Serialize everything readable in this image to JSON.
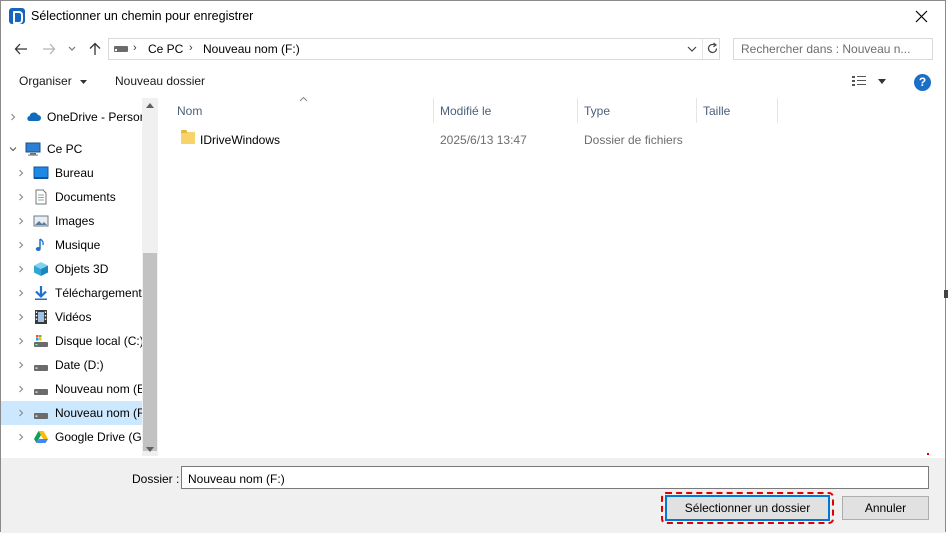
{
  "window": {
    "title": "Sélectionner un chemin pour enregistrer"
  },
  "address_bar": {
    "crumbs": [
      "Ce PC",
      "Nouveau nom (F:)"
    ]
  },
  "search": {
    "placeholder": "Rechercher dans : Nouveau n..."
  },
  "toolbar": {
    "organize_label": "Organiser",
    "new_folder_label": "Nouveau dossier",
    "help_label": "?"
  },
  "nav_pane": {
    "items": [
      {
        "label": "OneDrive - Person",
        "icon": "onedrive-cloud-icon",
        "level": 0,
        "selected": false
      },
      {
        "label": "Ce PC",
        "icon": "computer-icon",
        "level": 0,
        "expanded": true,
        "selected": false
      },
      {
        "label": "Bureau",
        "icon": "desktop-icon",
        "level": 1,
        "selected": false
      },
      {
        "label": "Documents",
        "icon": "documents-icon",
        "level": 1,
        "selected": false
      },
      {
        "label": "Images",
        "icon": "pictures-icon",
        "level": 1,
        "selected": false
      },
      {
        "label": "Musique",
        "icon": "music-icon",
        "level": 1,
        "selected": false
      },
      {
        "label": "Objets 3D",
        "icon": "3d-objects-icon",
        "level": 1,
        "selected": false
      },
      {
        "label": "Téléchargements",
        "icon": "downloads-icon",
        "level": 1,
        "selected": false
      },
      {
        "label": "Vidéos",
        "icon": "videos-icon",
        "level": 1,
        "selected": false
      },
      {
        "label": "Disque local (C:)",
        "icon": "system-drive-icon",
        "level": 1,
        "selected": false
      },
      {
        "label": "Date (D:)",
        "icon": "drive-icon",
        "level": 1,
        "selected": false
      },
      {
        "label": "Nouveau nom (E",
        "icon": "drive-icon",
        "level": 1,
        "selected": false
      },
      {
        "label": "Nouveau nom (F",
        "icon": "drive-icon",
        "level": 1,
        "selected": true
      },
      {
        "label": "Google Drive (G:",
        "icon": "google-drive-icon",
        "level": 1,
        "selected": false
      }
    ]
  },
  "file_list": {
    "columns": [
      "Nom",
      "Modifié le",
      "Type",
      "Taille"
    ],
    "rows": [
      {
        "name": "IDriveWindows",
        "modified": "2025/6/13 13:47",
        "type": "Dossier de fichiers",
        "size": ""
      }
    ]
  },
  "footer": {
    "folder_label": "Dossier :",
    "folder_value": "Nouveau nom (F:)",
    "select_button": "Sélectionner un dossier",
    "cancel_button": "Annuler"
  },
  "colors": {
    "selection": "#cce8ff",
    "accent": "#0078d7",
    "highlight_outline": "#e00000",
    "help_icon": "#1a6fc9"
  }
}
